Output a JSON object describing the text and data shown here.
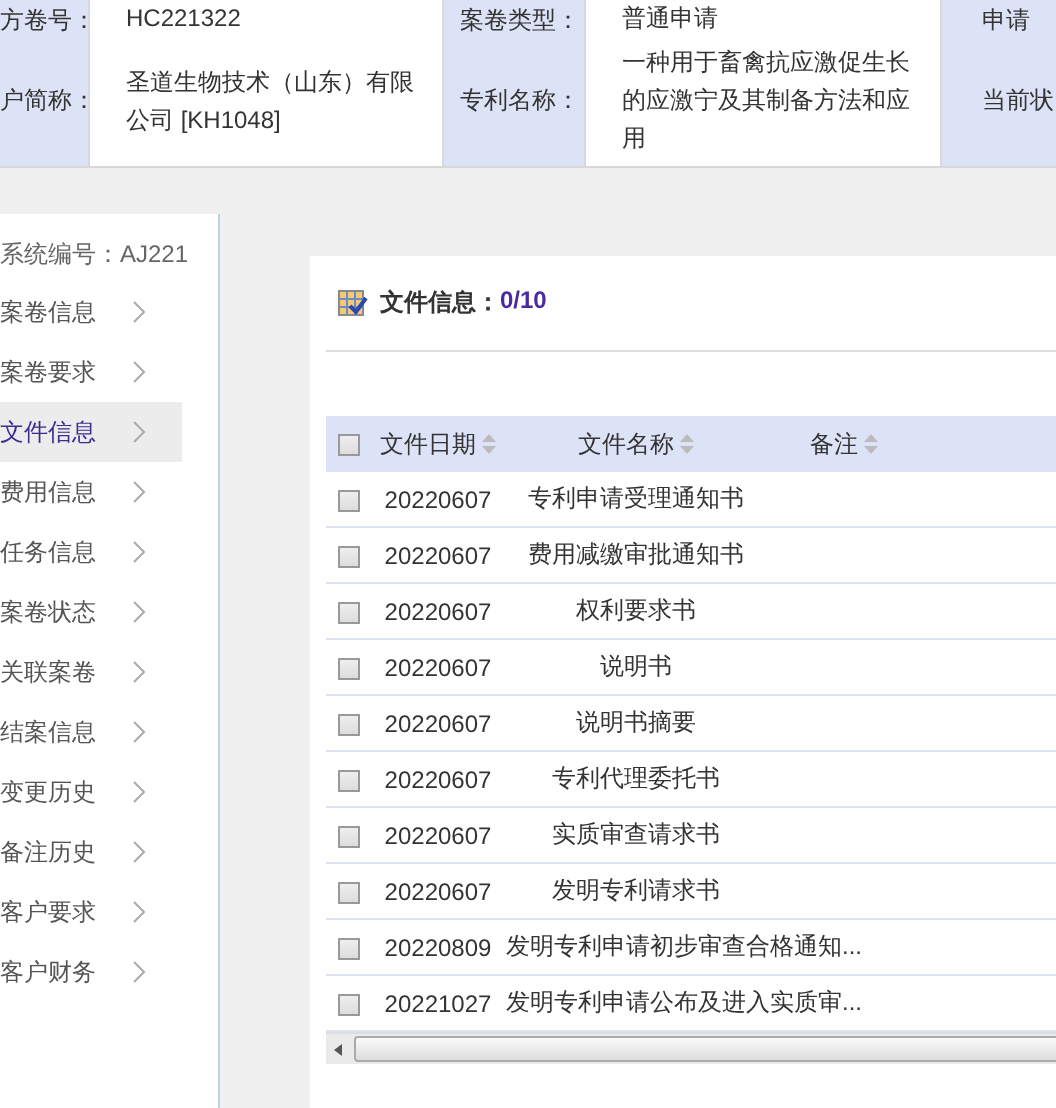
{
  "case_info": {
    "rows": [
      {
        "fields": [
          {
            "label": "方卷号：",
            "value": "HC221322"
          },
          {
            "label": "案卷类型：",
            "value": "普通申请"
          },
          {
            "label": "申请"
          }
        ]
      },
      {
        "fields": [
          {
            "label": "户简称：",
            "value": "圣道生物技术（山东）有限公司 [KH1048]"
          },
          {
            "label": "专利名称：",
            "value": "一种用于畜禽抗应激促生长的应激宁及其制备方法和应用"
          },
          {
            "label": "当前状"
          }
        ]
      }
    ]
  },
  "sidebar": {
    "system_number": "系统编号：AJ221",
    "items": [
      {
        "label": "案卷信息",
        "selected": false
      },
      {
        "label": "案卷要求",
        "selected": false
      },
      {
        "label": "文件信息",
        "selected": true
      },
      {
        "label": "费用信息",
        "selected": false
      },
      {
        "label": "任务信息",
        "selected": false
      },
      {
        "label": "案卷状态",
        "selected": false
      },
      {
        "label": "关联案卷",
        "selected": false
      },
      {
        "label": "结案信息",
        "selected": false
      },
      {
        "label": "变更历史",
        "selected": false
      },
      {
        "label": "备注历史",
        "selected": false
      },
      {
        "label": "客户要求",
        "selected": false
      },
      {
        "label": "客户财务",
        "selected": false
      }
    ]
  },
  "files": {
    "title": "文件信息：",
    "count": "0/10",
    "select_all_checked": false,
    "columns": [
      "文件日期",
      "文件名称",
      "备注"
    ],
    "rows": [
      {
        "date": "20220607",
        "name": "专利申请受理通知书",
        "checked": false
      },
      {
        "date": "20220607",
        "name": "费用减缴审批通知书",
        "checked": false
      },
      {
        "date": "20220607",
        "name": "权利要求书",
        "checked": false
      },
      {
        "date": "20220607",
        "name": "说明书",
        "checked": false
      },
      {
        "date": "20220607",
        "name": "说明书摘要",
        "checked": false
      },
      {
        "date": "20220607",
        "name": "专利代理委托书",
        "checked": false
      },
      {
        "date": "20220607",
        "name": "实质审查请求书",
        "checked": false
      },
      {
        "date": "20220607",
        "name": "发明专利请求书",
        "checked": false
      },
      {
        "date": "20220809",
        "name": "发明专利申请初步审查合格通知...",
        "checked": false
      },
      {
        "date": "20221027",
        "name": "发明专利申请公布及进入实质审...",
        "checked": false
      }
    ]
  }
}
